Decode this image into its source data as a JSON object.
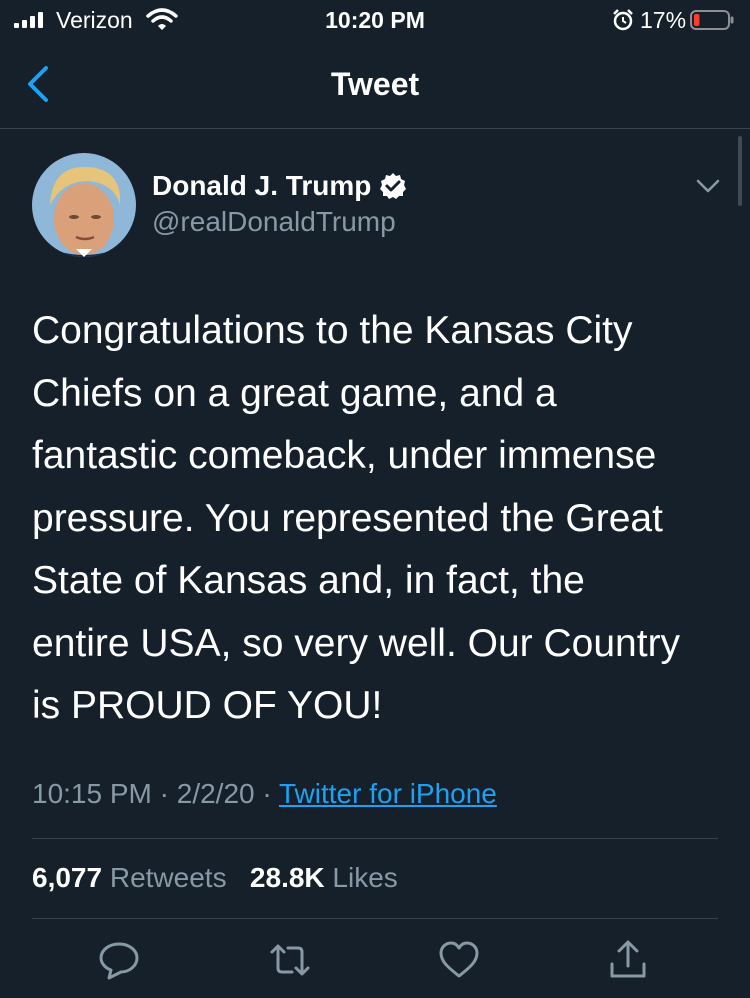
{
  "status_bar": {
    "carrier": "Verizon",
    "time": "10:20 PM",
    "battery_percent": "17%",
    "battery_level": 0.17,
    "battery_color": "#ff3b30"
  },
  "nav": {
    "title": "Tweet",
    "back_icon": "chevron-left-icon"
  },
  "tweet": {
    "author_name": "Donald J. Trump",
    "author_handle": "@realDonaldTrump",
    "verified": true,
    "text": "Congratulations to the Kansas City\nChiefs on a great game, and a\nfantastic comeback, under immense\npressure. You represented the Great\nState of Kansas and, in fact, the\nentire USA, so very well. Our Country\nis PROUD OF YOU!",
    "time": "10:15 PM",
    "date": "2/2/20",
    "separator": "·",
    "source": "Twitter for iPhone",
    "retweets_count": "6,077",
    "retweets_label": "Retweets",
    "likes_count": "28.8K",
    "likes_label": "Likes"
  },
  "actions": [
    "reply-icon",
    "retweet-icon",
    "like-icon",
    "share-icon"
  ],
  "colors": {
    "background": "#15202b",
    "accent": "#1da1f2",
    "secondary_text": "#8899a6",
    "divider": "#38444d"
  }
}
